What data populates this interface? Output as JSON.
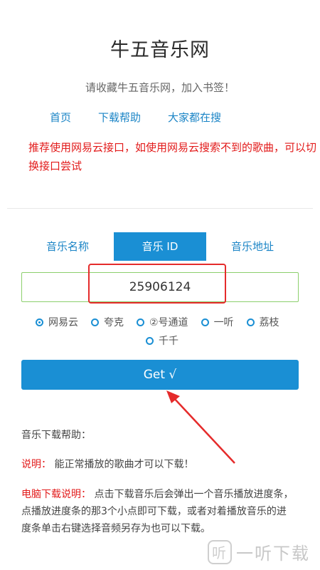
{
  "header": {
    "title": "牛五音乐网",
    "subtitle": "请收藏牛五音乐网，加入书签！"
  },
  "nav": [
    {
      "label": "首页"
    },
    {
      "label": "下载帮助"
    },
    {
      "label": "大家都在搜"
    }
  ],
  "notice": "推荐使用网易云接口，如使用网易云搜索不到的歌曲，可以切换接口尝试",
  "tabs": [
    {
      "label": "音乐名称"
    },
    {
      "label": "音乐 ID"
    },
    {
      "label": "音乐地址"
    }
  ],
  "search": {
    "value": "25906124"
  },
  "sources": [
    {
      "label": "网易云",
      "selected": true
    },
    {
      "label": "夸克",
      "selected": false
    },
    {
      "label": "②号通道",
      "selected": false
    },
    {
      "label": "一听",
      "selected": false
    },
    {
      "label": "荔枝",
      "selected": false
    },
    {
      "label": "千千",
      "selected": false
    }
  ],
  "get_button": "Get √",
  "help": {
    "title": "音乐下载帮助：",
    "note_label": "说明：",
    "note_text": "能正常播放的歌曲才可以下载！",
    "pc_label": "电脑下载说明：",
    "pc_text": "点击下载音乐后会弹出一个音乐播放进度条，点播放进度条的那3个小点即可下载，或者对着播放音乐的进度条单击右键选择音频另存为也可以下载。"
  },
  "watermark": {
    "logo_glyph": "听",
    "text": "一听下载"
  },
  "colors": {
    "accent": "#1a8fd4",
    "link": "#1a84c6",
    "warning": "#e21a1a",
    "input_border": "#8ccf6d"
  }
}
